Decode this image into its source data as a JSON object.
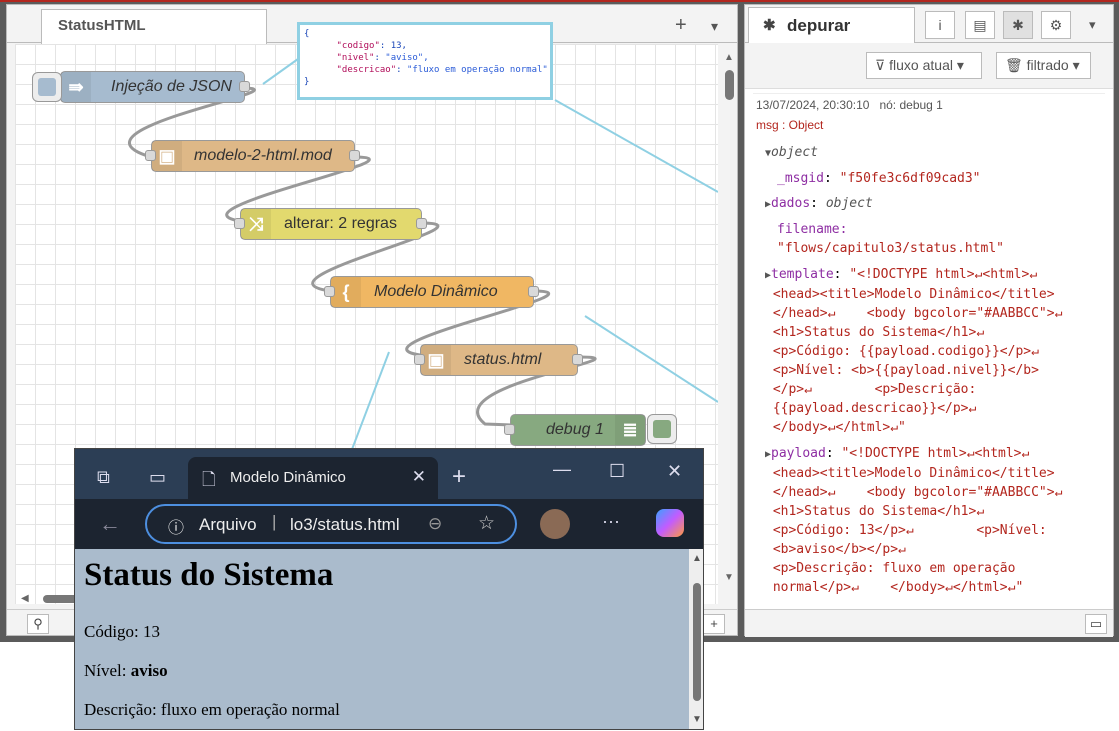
{
  "workspace": {
    "tab_title": "StatusHTML",
    "add_btn": "+",
    "menu_btn": "▾",
    "json_tooltip": {
      "open": "{",
      "line1_key": "\"codigo\"",
      "line1_val": "13,",
      "line2_key": "\"nivel\"",
      "line2_val": "\"aviso\",",
      "line3_key": "\"descricao\"",
      "line3_val": "\"fluxo em operação normal\"",
      "close": "}"
    },
    "nodes": {
      "inject": "Injeção de JSON",
      "template_file": "modelo-2-html.mod",
      "change": "alterar: 2 regras",
      "template": "Modelo Dinâmico",
      "file_out": "status.html",
      "debug": "debug 1"
    },
    "footer_zoom_btn": "+"
  },
  "sidebar": {
    "tab_label": "depurar",
    "filter_flow": "fluxo atual",
    "filter_mode": "filtrado",
    "message": {
      "timestamp": "13/07/2024, 20:30:10",
      "node": "nó: debug 1",
      "type": "msg : Object",
      "root": "object",
      "msgid_key": "_msgid",
      "msgid_val": "\"f50fe3c6df09cad3\"",
      "dados_key": "dados",
      "dados_val": "object",
      "filename_key": "filename:",
      "filename_val": "\"flows/capitulo3/status.html\"",
      "template_key": "template",
      "template_lines": [
        "\"<!DOCTYPE html>↵<html>↵",
        "<head><title>Modelo Dinâmico</title>",
        "</head>↵    <body bgcolor=\"#AABBCC\">↵",
        "<h1>Status do Sistema</h1>↵",
        "<p>Código: {{payload.codigo}}</p>↵",
        "<p>Nível: <b>{{payload.nivel}}</b>",
        "</p>↵        <p>Descrição:",
        "{{payload.descricao}}</p>↵",
        "</body>↵</html>↵\""
      ],
      "payload_key": "payload",
      "payload_lines": [
        "\"<!DOCTYPE html>↵<html>↵",
        "<head><title>Modelo Dinâmico</title>",
        "</head>↵    <body bgcolor=\"#AABBCC\">↵",
        "<h1>Status do Sistema</h1>↵",
        "<p>Código: 13</p>↵        <p>Nível:",
        "<b>aviso</b></p>↵",
        "<p>Descrição: fluxo em operação",
        "normal</p>↵    </body>↵</html>↵\""
      ]
    }
  },
  "browser": {
    "tab_title": "Modelo Dinâmico",
    "address_prefix": "Arquivo",
    "address_url": "lo3/status.html",
    "page": {
      "heading": "Status do Sistema",
      "codigo": "Código: 13",
      "nivel_label": "Nível: ",
      "nivel_value": "aviso",
      "descricao": "Descrição: fluxo em operação normal"
    },
    "page_bg": "#aabbcc"
  },
  "colors": {
    "inject": "#a6bbcf",
    "template_file": "#deb887",
    "change": "#e2d96e",
    "template": "#f0b763",
    "file_out": "#deb887",
    "debug": "#87a980",
    "callout": "#8fd0e3"
  }
}
